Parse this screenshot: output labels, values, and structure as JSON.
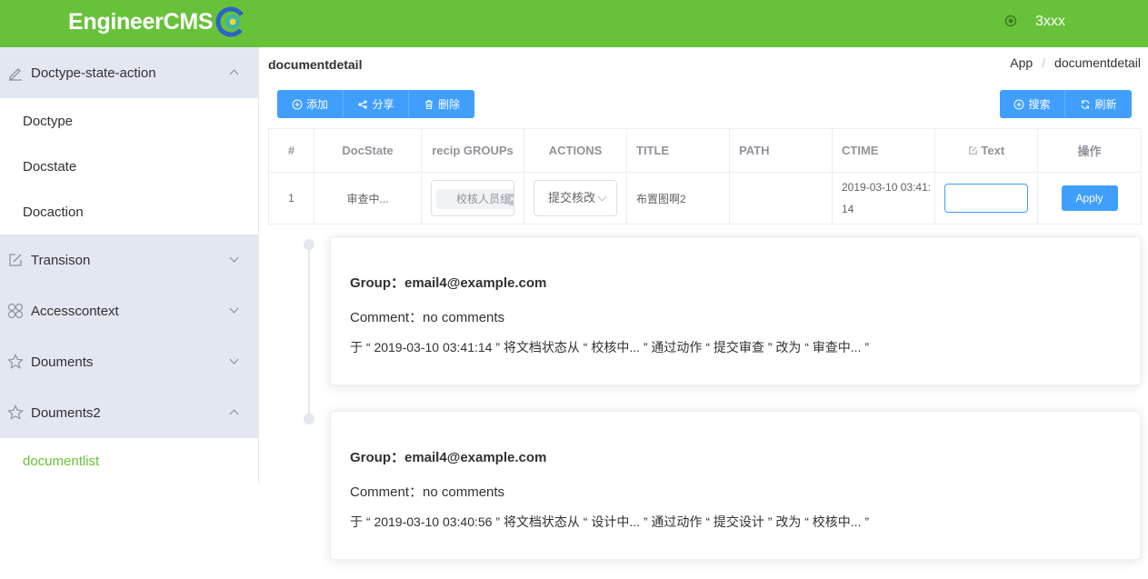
{
  "header": {
    "logo_text": "EngineerCMS",
    "user_name": "3xxx",
    "brand_color": "#67c23a"
  },
  "sidebar": {
    "submenus": [
      {
        "label": "Doctype-state-action",
        "icon": "edit-icon",
        "expanded": true,
        "items": [
          {
            "label": "Doctype"
          },
          {
            "label": "Docstate"
          },
          {
            "label": "Docaction"
          }
        ]
      },
      {
        "label": "Transison",
        "icon": "edit-square-icon",
        "expanded": false
      },
      {
        "label": "Accesscontext",
        "icon": "grid-icon",
        "expanded": false
      },
      {
        "label": "Douments",
        "icon": "star-icon",
        "expanded": false
      },
      {
        "label": "Douments2",
        "icon": "star-icon",
        "expanded": true,
        "items": [
          {
            "label": "documentlist",
            "active": true
          }
        ]
      }
    ]
  },
  "page": {
    "title": "documentdetail",
    "breadcrumb": [
      "App",
      "documentdetail"
    ]
  },
  "toolbar": {
    "left": [
      {
        "label": "添加",
        "icon": "plus-circle-icon"
      },
      {
        "label": "分享",
        "icon": "share-icon"
      },
      {
        "label": "删除",
        "icon": "trash-icon"
      }
    ],
    "right": [
      {
        "label": "搜索",
        "icon": "search-icon"
      },
      {
        "label": "刷新",
        "icon": "refresh-icon"
      }
    ],
    "button_color": "#409eff"
  },
  "table": {
    "headers": [
      "#",
      "DocState",
      "recip GROUPs",
      "ACTIONS",
      "TITLE",
      "PATH",
      "CTIME",
      "Text",
      "操作"
    ],
    "rows": [
      {
        "index": "1",
        "docstate": "审查中...",
        "group_tag": "校核人员组",
        "action_selected": "提交核改",
        "title": "布置图啊2",
        "path": "",
        "ctime": "2019-03-10 03:41:14",
        "text_value": "",
        "apply_label": "Apply"
      }
    ]
  },
  "timeline": [
    {
      "group": "Group：email4@example.com",
      "comment": "Comment：no comments",
      "history": "于 “ 2019-03-10 03:41:14 ” 将文档状态从 “ 校核中... ” 通过动作 “ 提交审查 ” 改为 “ 审查中... ”"
    },
    {
      "group": "Group：email4@example.com",
      "comment": "Comment：no comments",
      "history": "于 “ 2019-03-10 03:40:56 ” 将文档状态从 “ 设计中... ” 通过动作 “ 提交设计 ” 改为 “ 校核中... ”"
    }
  ]
}
